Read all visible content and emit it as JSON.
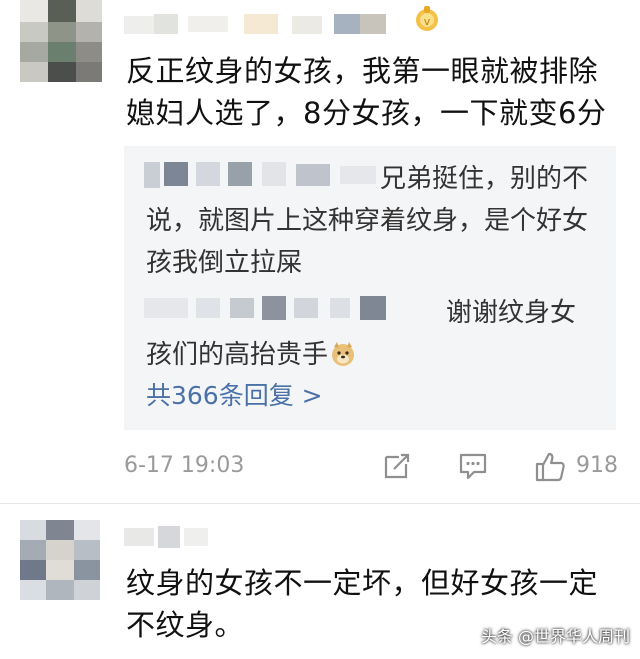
{
  "comment1": {
    "text": "反正纹身的女孩，我第一眼就被排除\n媳妇人选了，8分女孩，一下就变6分",
    "replies": [
      {
        "text": "兄弟挺住，别的不说，就图片上这种穿着纹身，是个好女孩我倒立拉屎"
      },
      {
        "text": "谢谢纹身女孩们的高抬贵手"
      }
    ],
    "reply_count_label": "共366条回复 >",
    "date": "6-17 19:03",
    "likes": "918"
  },
  "comment2": {
    "text": "纹身的女孩不一定坏，但好女孩一定\n不纹身。"
  },
  "watermark": "头条 @世界华人周刊",
  "colors": {
    "link": "#4a71a8",
    "reply_bg": "#f4f5f7",
    "meta": "#9a9a9a"
  },
  "icons": [
    "vip-badge-icon",
    "doge-emoji-icon",
    "share-icon",
    "comment-icon",
    "like-icon"
  ]
}
